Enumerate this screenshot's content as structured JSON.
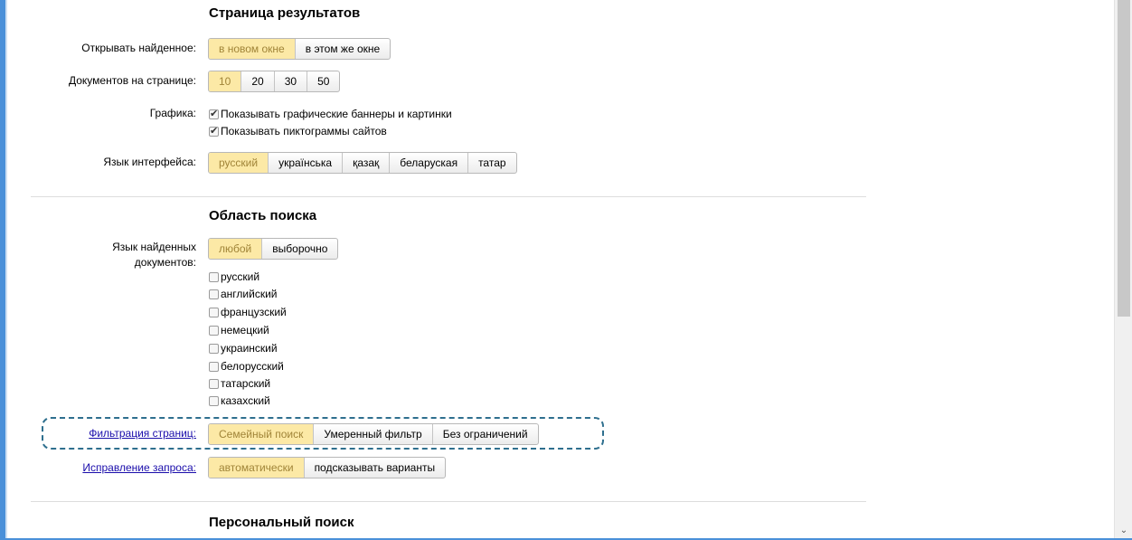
{
  "results_section": {
    "title": "Страница результатов",
    "open_found": {
      "label": "Открывать найденное:",
      "options": [
        "в новом окне",
        "в этом же окне"
      ],
      "selected": "в новом окне"
    },
    "docs_per_page": {
      "label": "Документов на странице:",
      "options": [
        "10",
        "20",
        "30",
        "50"
      ],
      "selected": "10"
    },
    "graphics": {
      "label": "Графика:",
      "items": [
        {
          "text": "Показывать графические баннеры и картинки",
          "checked": true
        },
        {
          "text": "Показывать пиктограммы сайтов",
          "checked": true
        }
      ]
    },
    "interface_language": {
      "label": "Язык интерфейса:",
      "options": [
        "русский",
        "українська",
        "қазақ",
        "беларуская",
        "татар"
      ],
      "selected": "русский"
    }
  },
  "search_area": {
    "title": "Область поиска",
    "docs_language": {
      "label_line1": "Язык найденных",
      "label_line2": "документов:",
      "options": [
        "любой",
        "выборочно"
      ],
      "selected": "любой",
      "languages": [
        {
          "text": "русский",
          "checked": false
        },
        {
          "text": "английский",
          "checked": false
        },
        {
          "text": "французский",
          "checked": false
        },
        {
          "text": "немецкий",
          "checked": false
        },
        {
          "text": "украинский",
          "checked": false
        },
        {
          "text": "белорусский",
          "checked": false
        },
        {
          "text": "татарский",
          "checked": false
        },
        {
          "text": "казахский",
          "checked": false
        }
      ]
    },
    "page_filter": {
      "label": "Фильтрация страниц:",
      "options": [
        "Семейный поиск",
        "Умеренный фильтр",
        "Без ограничений"
      ],
      "selected": "Семейный поиск"
    },
    "query_correction": {
      "label": "Исправление запроса:",
      "options": [
        "автоматически",
        "подсказывать варианты"
      ],
      "selected": "автоматически"
    }
  },
  "personal_section": {
    "title": "Персональный поиск"
  },
  "colors": {
    "active_bg": "#fce9a6",
    "active_text": "#a08438",
    "link": "#1a0dab",
    "highlight_border": "#2e6f8e"
  },
  "icons": {
    "checkbox_checked": "check-mark-icon",
    "scroll_down": "chevron-down-icon"
  }
}
